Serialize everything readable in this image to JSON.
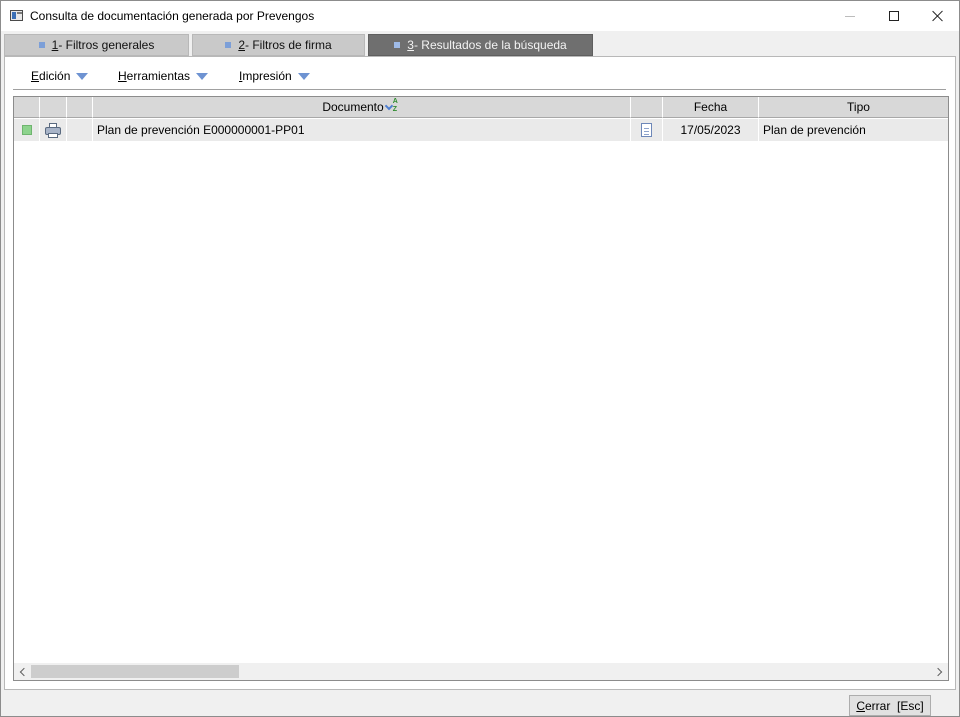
{
  "window": {
    "title": "Consulta de documentación generada por Prevengos"
  },
  "tabs": [
    {
      "num": "1",
      "label": " - Filtros generales",
      "active": false
    },
    {
      "num": "2",
      "label": " - Filtros de firma",
      "active": false
    },
    {
      "num": "3",
      "label": " - Resultados de la búsqueda",
      "active": true
    }
  ],
  "menus": [
    {
      "key": "E",
      "rest": "dición"
    },
    {
      "key": "H",
      "rest": "erramientas"
    },
    {
      "key": "I",
      "rest": "mpresión"
    }
  ],
  "grid": {
    "columns": {
      "documento": "Documento",
      "fecha": "Fecha",
      "tipo": "Tipo"
    },
    "sort_label": "A Z",
    "rows": [
      {
        "documento": "Plan de prevención E000000001-PP01",
        "fecha": "17/05/2023",
        "tipo": "Plan de prevención"
      }
    ]
  },
  "footer": {
    "close_key": "C",
    "close_rest": "errar  [Esc]"
  },
  "icons": {
    "status": "green-square-icon",
    "print": "printer-icon",
    "document": "document-icon"
  },
  "colors": {
    "active_tab": "#6f6f6f",
    "inactive_tab": "#c9c9c9",
    "header": "#d8d8d8",
    "row": "#eaeaea",
    "accent": "#6e93d2"
  }
}
